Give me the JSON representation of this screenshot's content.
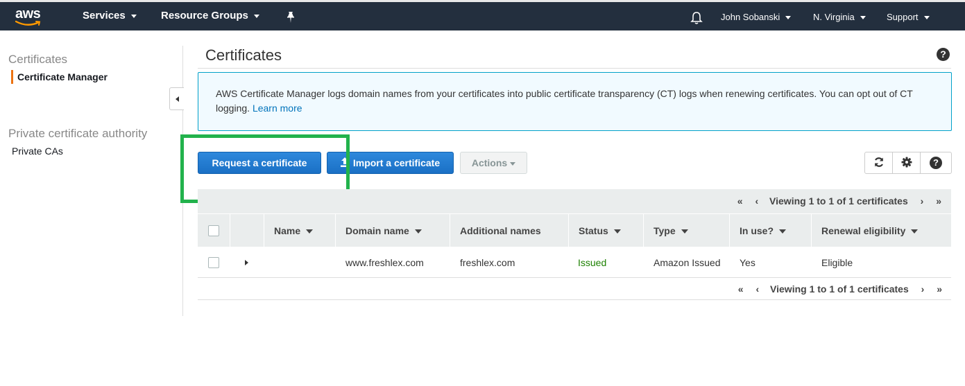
{
  "topnav": {
    "logo_text": "aws",
    "services": "Services",
    "resource_groups": "Resource Groups",
    "user": "John Sobanski",
    "region": "N. Virginia",
    "support": "Support",
    "bg_color": "#232f3e"
  },
  "sidebar": {
    "section1": "Certificates",
    "item_active": "Certificate Manager",
    "section2": "Private certificate authority",
    "item2": "Private CAs",
    "accent": "#ec7211"
  },
  "main": {
    "title": "Certificates",
    "info_text": "AWS Certificate Manager logs domain names from your certificates into public certificate transparency (CT) logs when renewing certificates. You can opt out of CT logging.",
    "info_link": "Learn more",
    "buttons": {
      "request": "Request a certificate",
      "import": "Import a certificate",
      "actions": "Actions"
    },
    "toolbar_icons": [
      "refresh-icon",
      "gear-icon",
      "help-icon"
    ],
    "pager_text": "Viewing 1 to 1 of 1 certificates",
    "columns": [
      "Name",
      "Domain name",
      "Additional names",
      "Status",
      "Type",
      "In use?",
      "Renewal eligibility"
    ],
    "rows": [
      {
        "name": "",
        "domain": "www.freshlex.com",
        "additional": "freshlex.com",
        "status": "Issued",
        "type": "Amazon Issued",
        "in_use": "Yes",
        "renewal": "Eligible"
      }
    ],
    "status_color": "#1d8102",
    "primary_color": "#1c7ad3"
  }
}
